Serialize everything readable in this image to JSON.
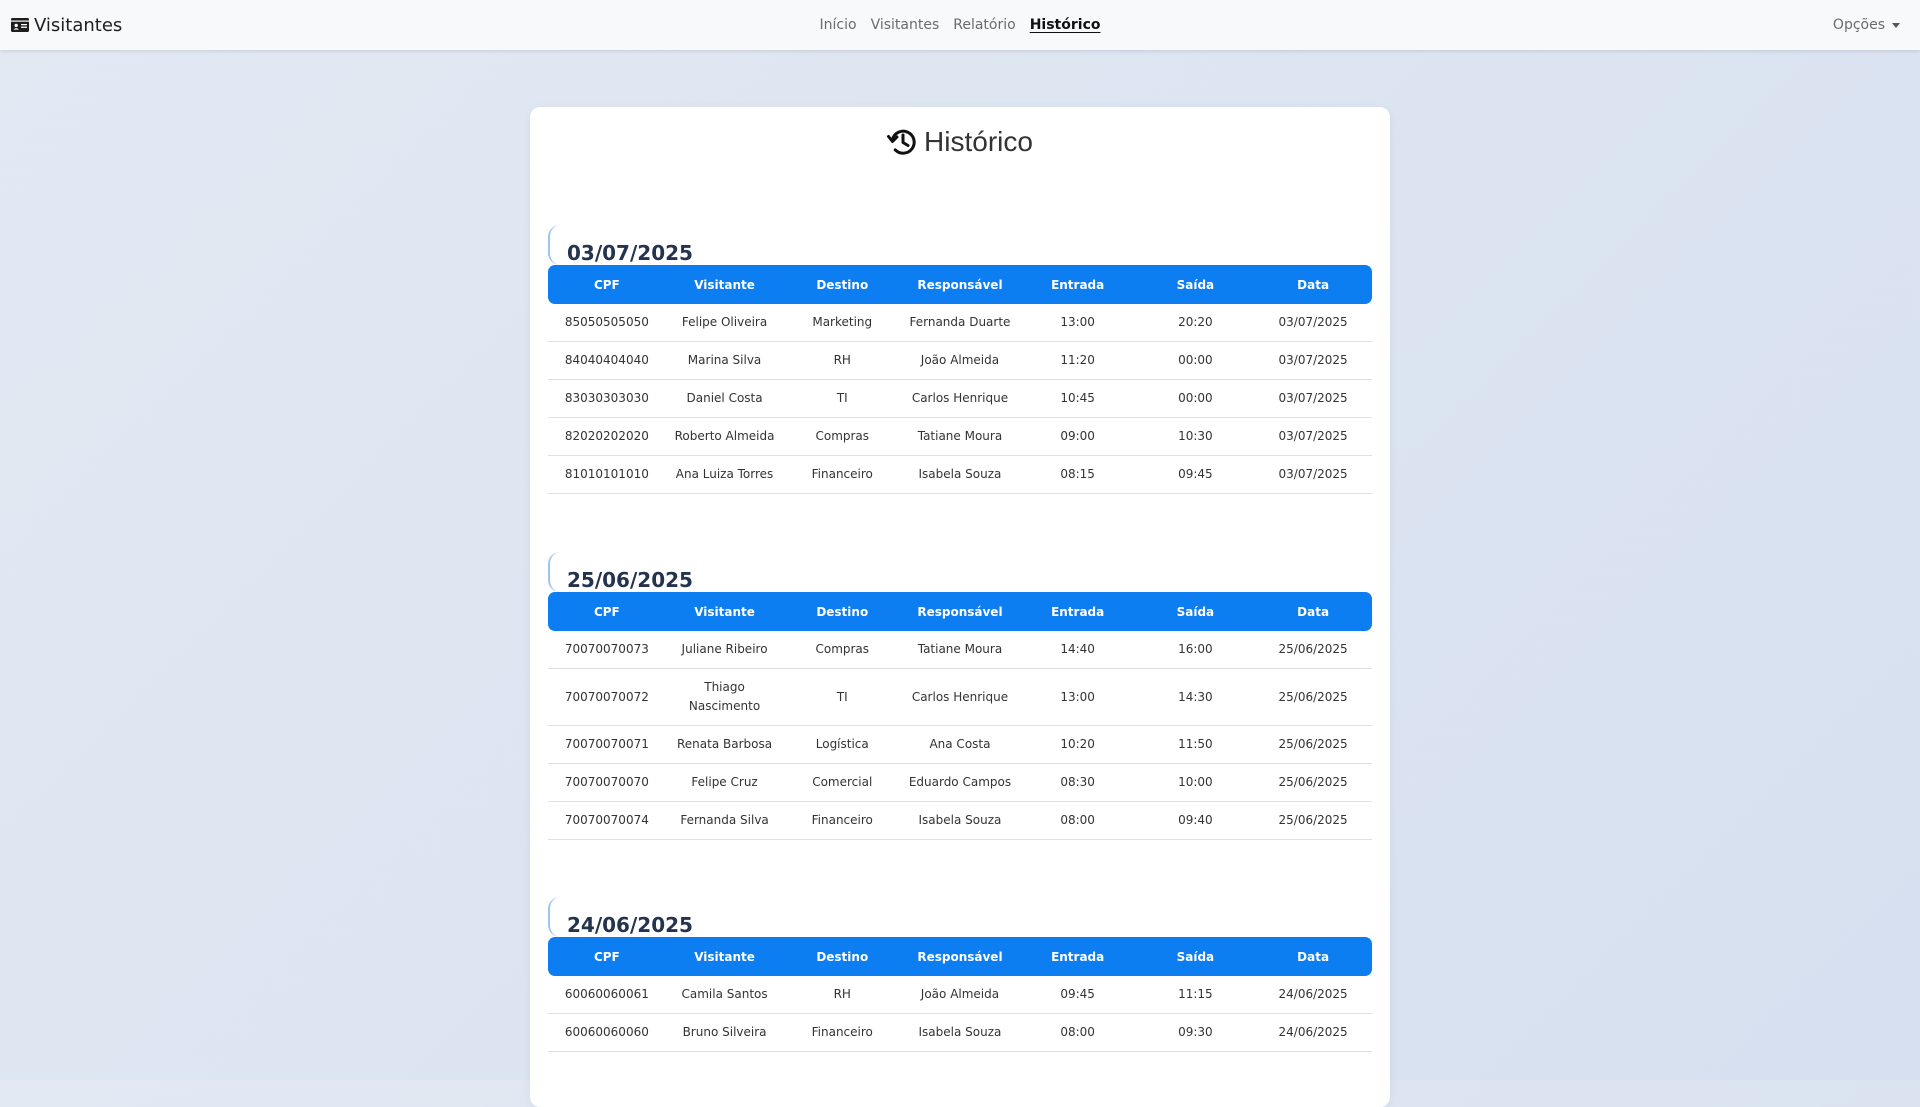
{
  "navbar": {
    "brand": "Visitantes",
    "brand_icon": "id-card-icon",
    "links": [
      "Início",
      "Visitantes",
      "Relatório",
      "Histórico"
    ],
    "active_link": "Histórico",
    "options_label": "Opções"
  },
  "page": {
    "title": "Histórico",
    "title_icon": "history-icon"
  },
  "columns": [
    "CPF",
    "Visitante",
    "Destino",
    "Responsável",
    "Entrada",
    "Saída",
    "Data"
  ],
  "sections": [
    {
      "date": "03/07/2025",
      "rows": [
        [
          "85050505050",
          "Felipe Oliveira",
          "Marketing",
          "Fernanda Duarte",
          "13:00",
          "20:20",
          "03/07/2025"
        ],
        [
          "84040404040",
          "Marina Silva",
          "RH",
          "João Almeida",
          "11:20",
          "00:00",
          "03/07/2025"
        ],
        [
          "83030303030",
          "Daniel Costa",
          "TI",
          "Carlos Henrique",
          "10:45",
          "00:00",
          "03/07/2025"
        ],
        [
          "82020202020",
          "Roberto Almeida",
          "Compras",
          "Tatiane Moura",
          "09:00",
          "10:30",
          "03/07/2025"
        ],
        [
          "81010101010",
          "Ana Luiza Torres",
          "Financeiro",
          "Isabela Souza",
          "08:15",
          "09:45",
          "03/07/2025"
        ]
      ]
    },
    {
      "date": "25/06/2025",
      "rows": [
        [
          "70070070073",
          "Juliane Ribeiro",
          "Compras",
          "Tatiane Moura",
          "14:40",
          "16:00",
          "25/06/2025"
        ],
        [
          "70070070072",
          "Thiago Nascimento",
          "TI",
          "Carlos Henrique",
          "13:00",
          "14:30",
          "25/06/2025"
        ],
        [
          "70070070071",
          "Renata Barbosa",
          "Logística",
          "Ana Costa",
          "10:20",
          "11:50",
          "25/06/2025"
        ],
        [
          "70070070070",
          "Felipe Cruz",
          "Comercial",
          "Eduardo Campos",
          "08:30",
          "10:00",
          "25/06/2025"
        ],
        [
          "70070070074",
          "Fernanda Silva",
          "Financeiro",
          "Isabela Souza",
          "08:00",
          "09:40",
          "25/06/2025"
        ]
      ]
    },
    {
      "date": "24/06/2025",
      "rows": [
        [
          "60060060061",
          "Camila Santos",
          "RH",
          "João Almeida",
          "09:45",
          "11:15",
          "24/06/2025"
        ],
        [
          "60060060060",
          "Bruno Silveira",
          "Financeiro",
          "Isabela Souza",
          "08:00",
          "09:30",
          "24/06/2025"
        ]
      ]
    }
  ],
  "colors": {
    "header_blue": "#0d7df2",
    "heading_text": "#24344f",
    "background": "#dde5f1"
  }
}
